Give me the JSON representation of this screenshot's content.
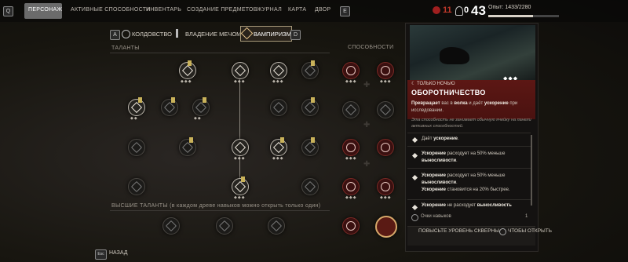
{
  "topbar": {
    "left_key": "Q",
    "tabs": [
      "ПЕРСОНАЖ",
      "АКТИВНЫЕ СПОСОБНОСТИ",
      "ИНВЕНТАРЬ",
      "СОЗДАНИЕ ПРЕДМЕТОВ",
      "ЖУРНАЛ",
      "КАРТА",
      "ДВОР"
    ],
    "right_key": "E",
    "health": "11",
    "zero": "0",
    "level": "43",
    "xp_label": "Опыт: 1433/2280",
    "xp_fraction": 0.628
  },
  "tree_tabs": {
    "left_key": "A",
    "items": [
      "КОЛДОВСТВО",
      "ВЛАДЕНИЕ МЕЧОМ",
      "ВАМПИРИЗМ"
    ],
    "right_key": "D"
  },
  "sections": {
    "talents": "ТАЛАНТЫ",
    "abilities": "СПОСОБНОСТИ",
    "higher": "ВЫСШИЕ ТАЛАНТЫ (в каждом древе навыков можно открыть только один)"
  },
  "panel": {
    "tag": "ТОЛЬКО НОЧЬЮ",
    "title": "ОБОРОТНИЧЕСТВО",
    "desc_html": "<b>Превращает</b> вас в <b>волка</b> и дает <b>ускорение</b> при исследовании.",
    "note": "Эта способность не занимает обычную ячейку на панели активных способностей.",
    "bullet1": "Дает <b>ускорение</b>.",
    "bullet2": "<b>Ускорение</b> расходует на 50% меньше <b>выносливости</b>.",
    "bullet3a": "<b>Ускорение</b> расходует на 50% меньше <b>выносливости</b>.",
    "bullet3b": "<b>Ускорение</b> становится на 20% быстрее.",
    "bullet4": "<b>Ускорение</b> не расходует <b>выносливость</b>",
    "points_label": "Очки навыков",
    "points_value": "1",
    "upgrade_label": "ПОВЫСЬТЕ УРОВЕНЬ СКВЕРНЫ",
    "upgrade_tail": "ЧТОБЫ ОТКРЫТЬ"
  },
  "footer": {
    "key": "Esc",
    "back": "НАЗАД"
  }
}
